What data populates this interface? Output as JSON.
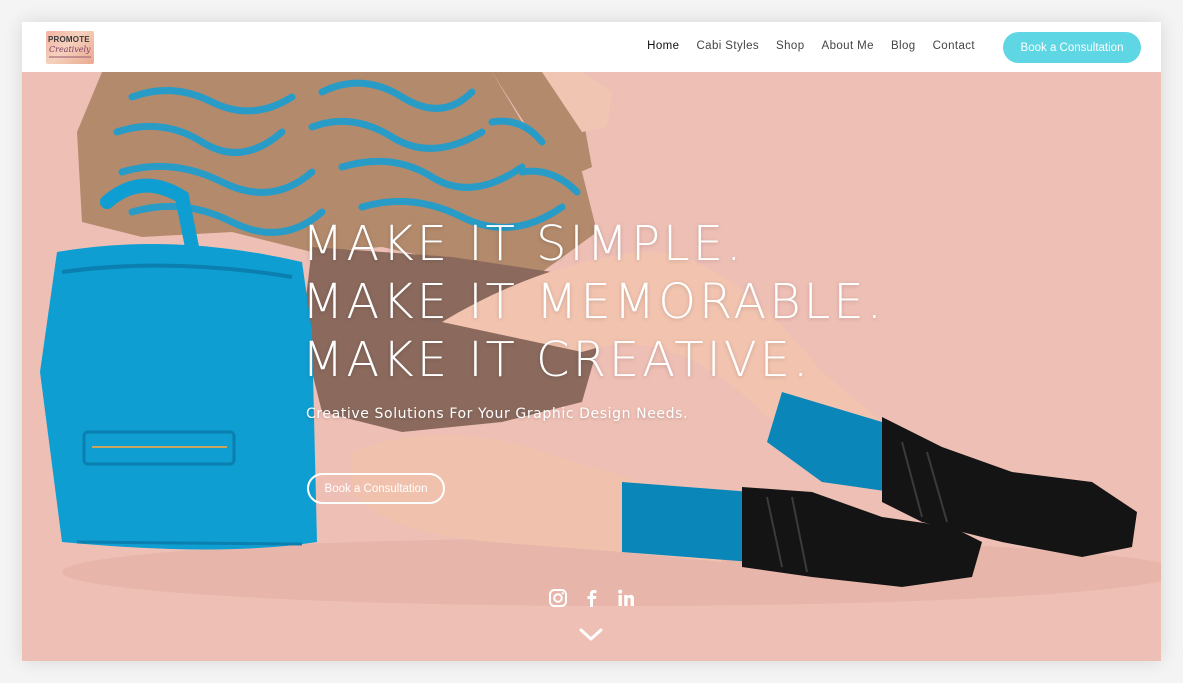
{
  "header": {
    "logo": {
      "text": "PROMOTE",
      "script": "Creatively"
    },
    "nav": [
      {
        "label": "Home"
      },
      {
        "label": "Cabi Styles"
      },
      {
        "label": "Shop"
      },
      {
        "label": "About Me"
      },
      {
        "label": "Blog"
      },
      {
        "label": "Contact"
      }
    ],
    "cta_label": "Book a Consultation"
  },
  "hero": {
    "headline": [
      "MAKE IT SIMPLE.",
      "MAKE IT MEMORABLE.",
      "MAKE IT CREATIVE."
    ],
    "subheadline": "Creative Solutions For Your Graphic Design Needs.",
    "cta_label": "Book a Consultation",
    "socials": [
      "instagram-icon",
      "facebook-icon",
      "linkedin-icon"
    ],
    "scroll_icon": "chevron-down-icon"
  },
  "colors": {
    "accent": "#5fd6e3",
    "hero_background": "#eebfb5",
    "bag": "#0f9ed1",
    "sweater": "#b38a6c",
    "socks": "#0b86b8",
    "boots": "#141414"
  }
}
